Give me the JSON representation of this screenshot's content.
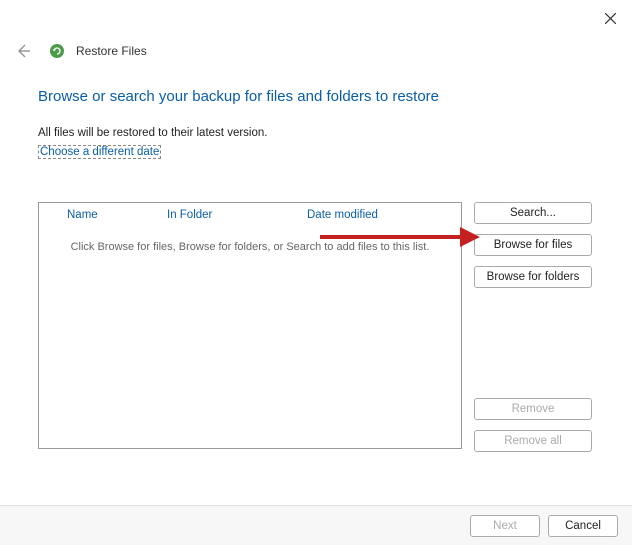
{
  "window": {
    "title": "Restore Files"
  },
  "heading": "Browse or search your backup for files and folders to restore",
  "subtext": "All files will be restored to their latest version.",
  "link": "Choose a different date",
  "list": {
    "col_name": "Name",
    "col_folder": "In Folder",
    "col_date": "Date modified",
    "empty_message": "Click Browse for files, Browse for folders, or Search to add files to this list."
  },
  "buttons": {
    "search": "Search...",
    "browse_files": "Browse for files",
    "browse_folders": "Browse for folders",
    "remove": "Remove",
    "remove_all": "Remove all"
  },
  "footer": {
    "next": "Next",
    "cancel": "Cancel"
  }
}
